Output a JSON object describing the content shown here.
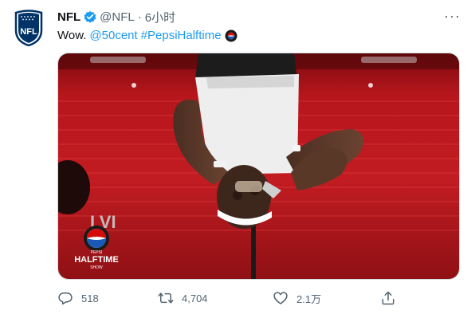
{
  "tweet": {
    "display_name": "NFL",
    "handle": "@NFL",
    "separator": "·",
    "time": "6小时",
    "text_prefix": "Wow.",
    "mention": "@50cent",
    "hashtag": "#PepsiHalftime",
    "avatar_logo_text": "NFL",
    "more_label": "···"
  },
  "media": {
    "overlay_logo_line1": "PEPSI",
    "overlay_logo_line2": "HALFTIME",
    "overlay_logo_line3": "SHOW"
  },
  "actions": {
    "reply_count": "518",
    "retweet_count": "4,704",
    "like_count": "2.1万"
  },
  "colors": {
    "link": "#1d9bf0",
    "verified": "#1d9bf0",
    "muted": "#536471",
    "nfl_blue": "#013369",
    "nfl_red": "#d50a0a"
  }
}
